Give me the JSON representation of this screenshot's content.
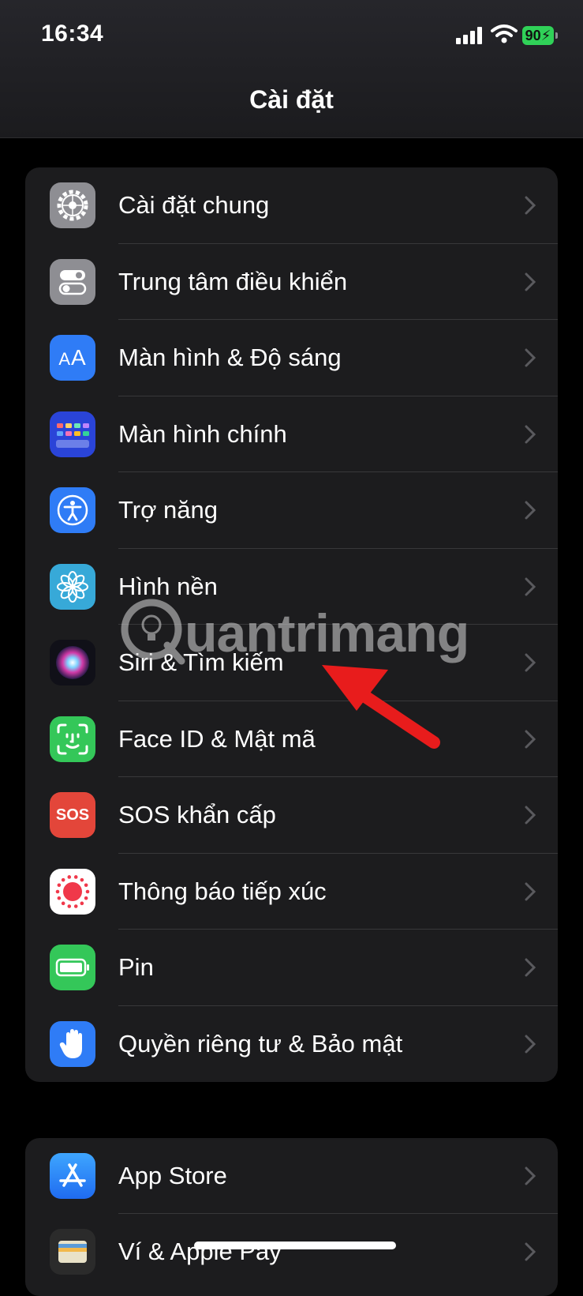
{
  "status": {
    "time": "16:34",
    "battery": "90"
  },
  "header": {
    "title": "Cài đặt"
  },
  "items": [
    {
      "label": "Cài đặt chung",
      "icon": "gear-icon",
      "color": "#8e8e93"
    },
    {
      "label": "Trung tâm điều khiển",
      "icon": "toggles-icon",
      "color": "#8e8e93"
    },
    {
      "label": "Màn hình & Độ sáng",
      "icon": "text-size-icon",
      "color": "#2f7cf6"
    },
    {
      "label": "Màn hình chính",
      "icon": "home-screen-grid-icon",
      "color": "#2a44d8"
    },
    {
      "label": "Trợ năng",
      "icon": "accessibility-icon",
      "color": "#2f7cf6"
    },
    {
      "label": "Hình nền",
      "icon": "flower-icon",
      "color": "#37a9d8"
    },
    {
      "label": "Siri & Tìm kiếm",
      "icon": "siri-icon",
      "color": "#1a1a2e"
    },
    {
      "label": "Face ID & Mật mã",
      "icon": "face-id-icon",
      "color": "#34c759"
    },
    {
      "label": "SOS khẩn cấp",
      "icon": "sos-icon",
      "color": "#e3463a",
      "icon_text": "SOS"
    },
    {
      "label": "Thông báo tiếp xúc",
      "icon": "exposure-dots-icon",
      "color": "#ffffff"
    },
    {
      "label": "Pin",
      "icon": "battery-icon",
      "color": "#34c759"
    },
    {
      "label": "Quyền riêng tư & Bảo mật",
      "icon": "hand-icon",
      "color": "#2f7cf6"
    }
  ],
  "items2": [
    {
      "label": "App Store",
      "icon": "app-store-icon",
      "color": "#2f8cf6"
    },
    {
      "label": "Ví & Apple Pay",
      "icon": "wallet-icon",
      "color": "#2b2b2b"
    }
  ],
  "watermark": {
    "text": "uantrimang"
  }
}
